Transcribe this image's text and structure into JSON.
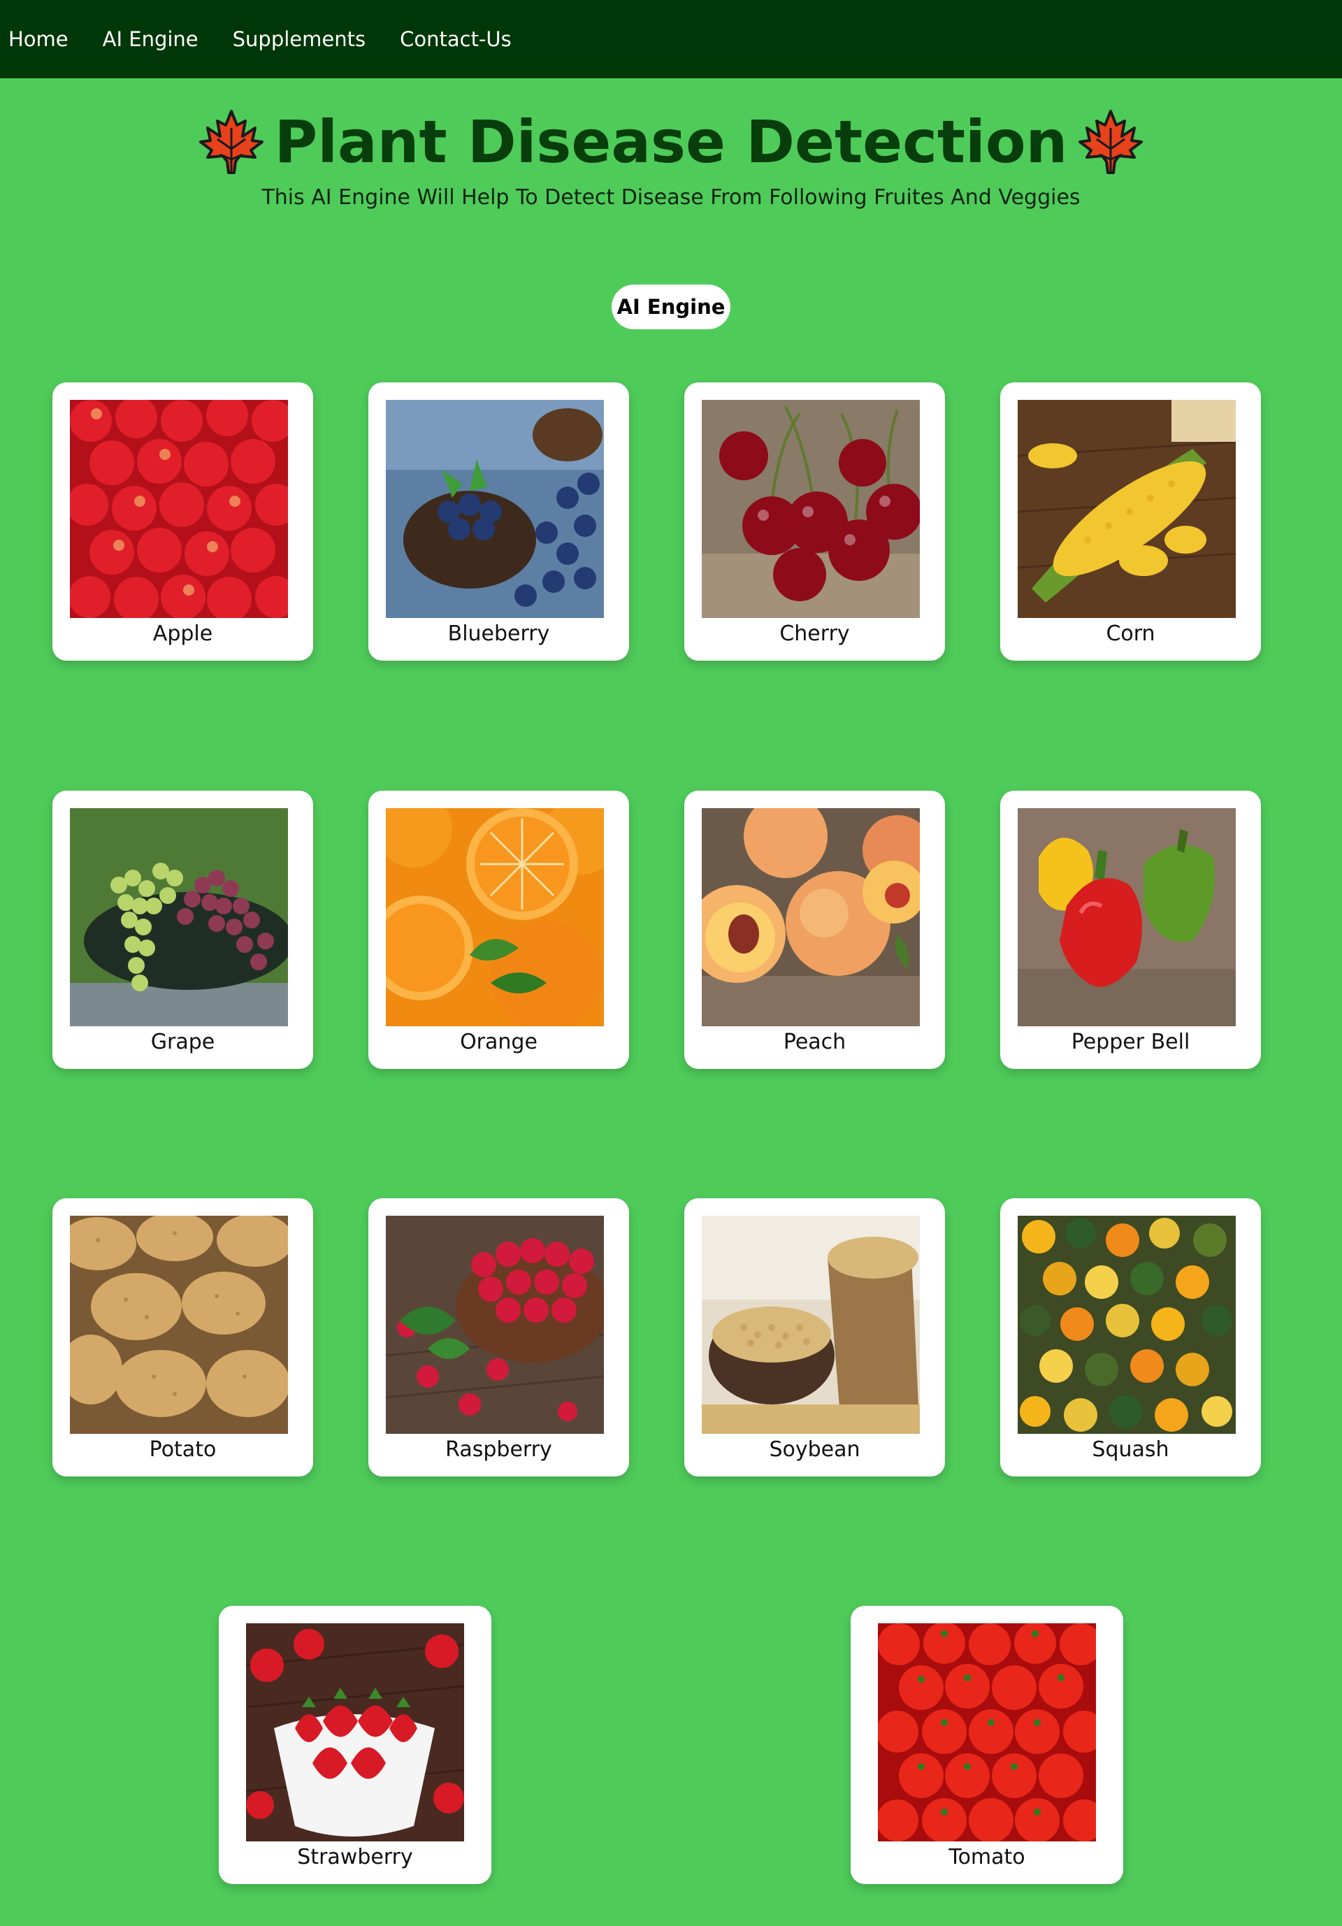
{
  "nav": {
    "items": [
      {
        "label": "Home"
      },
      {
        "label": "AI Engine"
      },
      {
        "label": "Supplements"
      },
      {
        "label": "Contact-Us"
      }
    ]
  },
  "header": {
    "title": "Plant Disease Detection",
    "subtitle": "This AI Engine Will Help To Detect Disease From Following Fruites And Veggies",
    "leaf_icon": "maple-leaf-icon"
  },
  "ai_button": {
    "label": "AI Engine"
  },
  "crops": [
    {
      "label": "Apple"
    },
    {
      "label": "Blueberry"
    },
    {
      "label": "Cherry"
    },
    {
      "label": "Corn"
    },
    {
      "label": "Grape"
    },
    {
      "label": "Orange"
    },
    {
      "label": "Peach"
    },
    {
      "label": "Pepper Bell"
    },
    {
      "label": "Potato"
    },
    {
      "label": "Raspberry"
    },
    {
      "label": "Soybean"
    },
    {
      "label": "Squash"
    },
    {
      "label": "Strawberry"
    },
    {
      "label": "Tomato"
    }
  ],
  "colors": {
    "page_bg": "#4fcb5a",
    "nav_bg": "#003708",
    "title": "#083d0c",
    "card_bg": "#ffffff",
    "leaf_red": "#e8421c"
  }
}
